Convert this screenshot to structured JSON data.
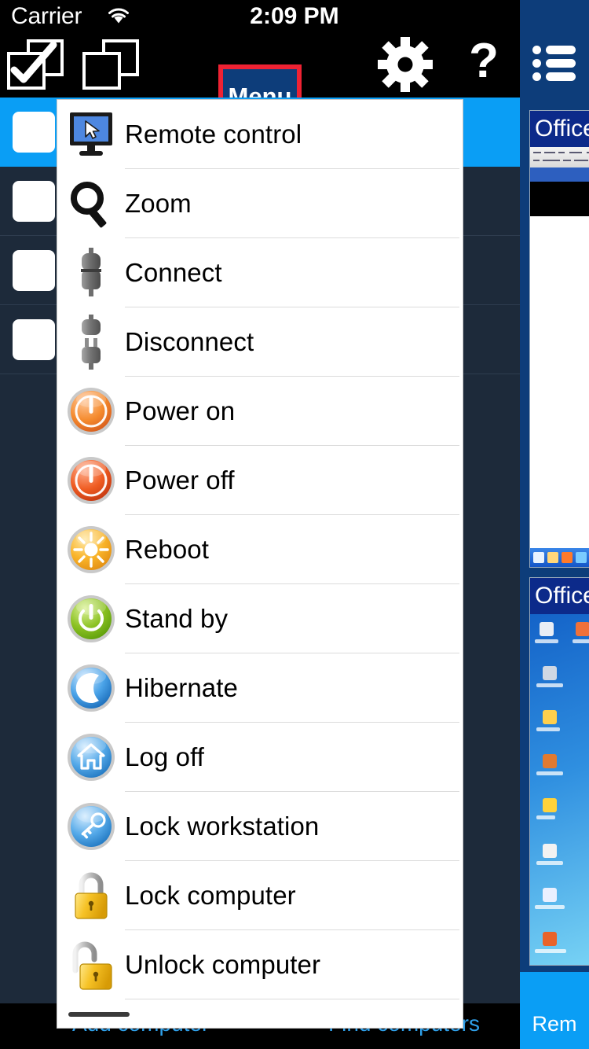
{
  "status_bar": {
    "carrier": "Carrier",
    "wifi_icon": "wifi-icon",
    "time": "2:09 PM",
    "battery_icon": "battery-icon"
  },
  "toolbar": {
    "select_all_icon": "select-all-checkbox-icon",
    "deselect_all_icon": "deselect-all-checkbox-icon",
    "menu_button_label": "Menu",
    "menu_button_bg": "#0d3d7a",
    "menu_button_border": "#ee2233",
    "settings_icon": "gear-icon",
    "help_icon": "question-mark-icon"
  },
  "right_rail": {
    "bg_color": "#0d3d7a",
    "list_icon": "list-view-icon",
    "thumbnails": [
      {
        "title": "Office",
        "type": "application-window-screenshot"
      },
      {
        "title": "Office",
        "type": "windows-desktop-screenshot"
      }
    ],
    "bottom_label": "Rem"
  },
  "computer_list": {
    "rows": [
      {
        "selected": true,
        "checkbox": "unchecked"
      },
      {
        "selected": false,
        "checkbox": "unchecked"
      },
      {
        "selected": false,
        "checkbox": "unchecked"
      },
      {
        "selected": false,
        "checkbox": "unchecked"
      }
    ],
    "selected_color": "#0a9ef5",
    "bg_color": "#1d2a3a"
  },
  "bottom_bar": {
    "add_label": "Add computer",
    "find_label": "Find computers",
    "link_color": "#2f9fe8"
  },
  "popover_menu": {
    "items": [
      {
        "label": "Remote control",
        "icon": "monitor-cursor-icon"
      },
      {
        "label": "Zoom",
        "icon": "magnifier-icon"
      },
      {
        "label": "Connect",
        "icon": "plug-connected-icon"
      },
      {
        "label": "Disconnect",
        "icon": "plug-disconnected-icon"
      },
      {
        "label": "Power on",
        "icon": "power-on-orange-icon"
      },
      {
        "label": "Power off",
        "icon": "power-off-red-icon"
      },
      {
        "label": "Reboot",
        "icon": "reboot-yellow-icon"
      },
      {
        "label": "Stand by",
        "icon": "standby-green-icon"
      },
      {
        "label": "Hibernate",
        "icon": "moon-blue-icon"
      },
      {
        "label": "Log off",
        "icon": "home-blue-icon"
      },
      {
        "label": "Lock workstation",
        "icon": "key-blue-icon"
      },
      {
        "label": "Lock computer",
        "icon": "padlock-closed-icon"
      },
      {
        "label": "Unlock computer",
        "icon": "padlock-open-icon"
      }
    ],
    "scroll_indicator": "vertical-scroll-indicator"
  }
}
